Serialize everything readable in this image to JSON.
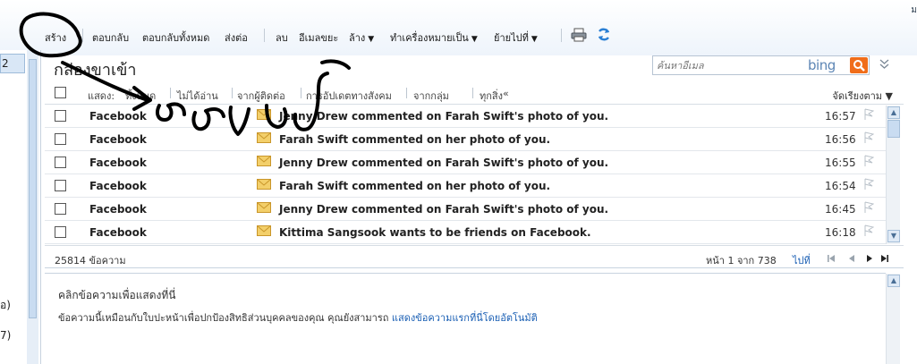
{
  "toolbar": {
    "new": "สร้าง",
    "reply": "ตอบกลับ",
    "reply_all": "ตอบกลับทั้งหมด",
    "forward": "ส่งต่อ",
    "delete": "ลบ",
    "junk": "อีเมลขยะ",
    "sweep": "ล้าง",
    "mark_as": "ทำเครื่องหมายเป็น",
    "move_to": "ย้ายไปที่",
    "top_right": "ม"
  },
  "leftnav": {
    "count": "2",
    "frag1": "อ)",
    "frag2": "7)"
  },
  "folder_title": "กล่องขาเข้า",
  "search": {
    "placeholder": "ค้นหาอีเมล",
    "brand": "bing"
  },
  "filters": {
    "show": "แสดง:",
    "all": "ทั้งหมด",
    "unread": "ไม่ได้อ่าน",
    "contacts": "จากผู้ติดต่อ",
    "social": "การอัปเดตทางสังคม",
    "groups": "จากกลุ่ม",
    "everything": "ทุกสิ่ง",
    "more": "«",
    "sort": "จัดเรียงตาม ▼"
  },
  "messages": [
    {
      "from": "Facebook",
      "subject": "Jenny Drew commented on Farah Swift's photo of you.",
      "time": "16:57"
    },
    {
      "from": "Facebook",
      "subject": "Farah Swift commented on her photo of you.",
      "time": "16:56"
    },
    {
      "from": "Facebook",
      "subject": "Jenny Drew commented on Farah Swift's photo of you.",
      "time": "16:55"
    },
    {
      "from": "Facebook",
      "subject": "Farah Swift commented on her photo of you.",
      "time": "16:54"
    },
    {
      "from": "Facebook",
      "subject": "Jenny Drew commented on Farah Swift's photo of you.",
      "time": "16:45"
    },
    {
      "from": "Facebook",
      "subject": "Kittima Sangsook wants to be friends on Facebook.",
      "time": "16:18"
    }
  ],
  "status": {
    "count": "25814 ข้อความ",
    "page": "หน้า 1 จาก 738",
    "goto": "ไปที่"
  },
  "reading": {
    "hint": "คลิกข้อความเพื่อแสดงที่นี่",
    "info": "ข้อความนี้เหมือนกับใบปะหน้าเพื่อปกป้องสิทธิส่วนบุคคลของคุณ คุณยังสามารถ",
    "link": "แสดงข้อความแรกที่นี่โดยอัตโนมัติ"
  },
  "colors": {
    "link": "#1a5fb4",
    "bing_go": "#f06d1a",
    "envelope": "#e8b84a"
  }
}
